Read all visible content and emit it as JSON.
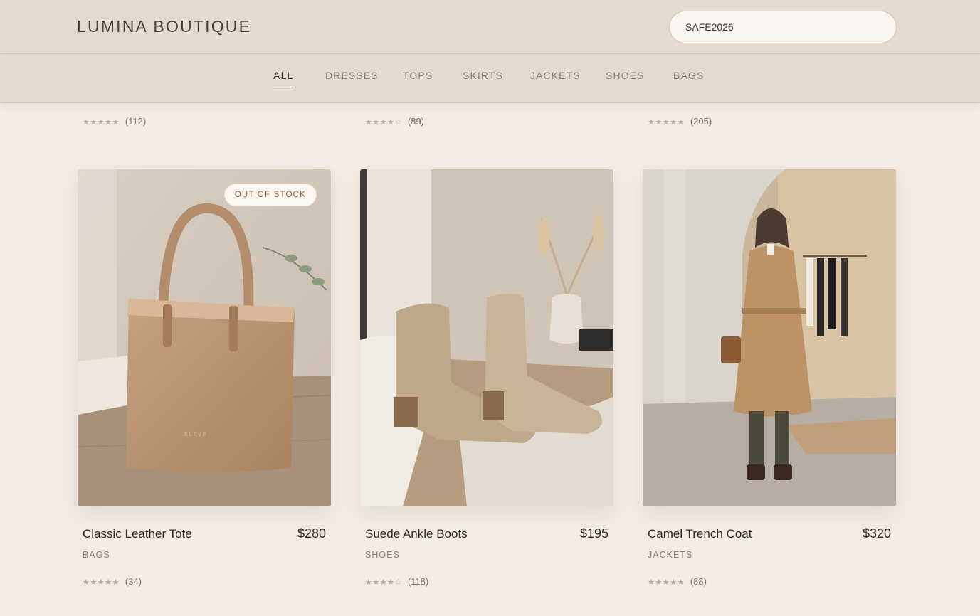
{
  "brand": {
    "name": "LUMINA BOUTIQUE"
  },
  "search": {
    "value": "SAFE2026"
  },
  "nav": {
    "items": [
      {
        "label": "ALL",
        "active": true
      },
      {
        "label": "DRESSES",
        "active": false
      },
      {
        "label": "TOPS",
        "active": false
      },
      {
        "label": "SKIRTS",
        "active": false
      },
      {
        "label": "JACKETS",
        "active": false
      },
      {
        "label": "SHOES",
        "active": false
      },
      {
        "label": "BAGS",
        "active": false
      }
    ]
  },
  "previous_row": [
    {
      "stars": "★★★★★",
      "count": "(112)"
    },
    {
      "stars": "★★★★☆",
      "count": "(89)"
    },
    {
      "stars": "★★★★★",
      "count": "(205)"
    }
  ],
  "products": [
    {
      "name": "Classic Leather Tote",
      "price": "$280",
      "category": "BAGS",
      "stars": "★★★★★",
      "reviews": "(34)",
      "badge": "OUT OF STOCK",
      "image_icon": "tote-bag-photo"
    },
    {
      "name": "Suede Ankle Boots",
      "price": "$195",
      "category": "SHOES",
      "stars": "★★★★☆",
      "reviews": "(118)",
      "badge": "",
      "image_icon": "ankle-boots-photo"
    },
    {
      "name": "Camel Trench Coat",
      "price": "$320",
      "category": "JACKETS",
      "stars": "★★★★★",
      "reviews": "(88)",
      "badge": "",
      "image_icon": "trench-coat-photo"
    }
  ],
  "colors": {
    "background": "#f3ebe4",
    "header": "#e5dace",
    "accent_text": "#3a322c",
    "muted_text": "#8a7d72",
    "badge_text": "#9b5a3c"
  }
}
